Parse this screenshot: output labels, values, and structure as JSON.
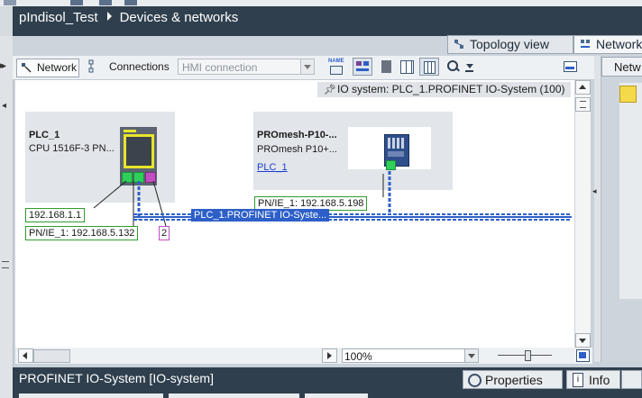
{
  "project": {
    "name": "pIndisol_Test",
    "editor": "Devices & networks"
  },
  "view_tabs": {
    "topology": "Topology view",
    "network": "Network view"
  },
  "toolbar": {
    "network_label": "Network",
    "connections_label": "Connections",
    "connection_type": "HMI connection",
    "name_icon_text": "NAME"
  },
  "io_system_banner": "IO system: PLC_1.PROFINET IO-System (100)",
  "devices": {
    "plc": {
      "name": "PLC_1",
      "type": "CPU 1516F-3 PN..."
    },
    "switch": {
      "name": "PROmesh-P10-...",
      "type": "PROmesh  P10+...",
      "controller_link": "PLC_1"
    }
  },
  "labels": {
    "plc_ip": "192.168.1.1",
    "plc_pnie": "PN/IE_1:  192.168.5.132",
    "plc_port_badge": "2",
    "switch_pnie": "PN/IE_1:  192.168.5.198",
    "network_name": "PLC_1.PROFINET IO-Syste..."
  },
  "zoom": "100%",
  "zoom_level": 1.0,
  "right_panel": {
    "tab": "Netw"
  },
  "inspector": {
    "title": "PROFINET IO-System [IO-system]",
    "properties_tab": "Properties",
    "info_tab": "Info"
  },
  "colors": {
    "ethernet_port": "#2fd05a",
    "network_line": "#2d5fc8",
    "label_highlight": "#2e9d2e",
    "dark_bar": "#2f3f4e"
  }
}
